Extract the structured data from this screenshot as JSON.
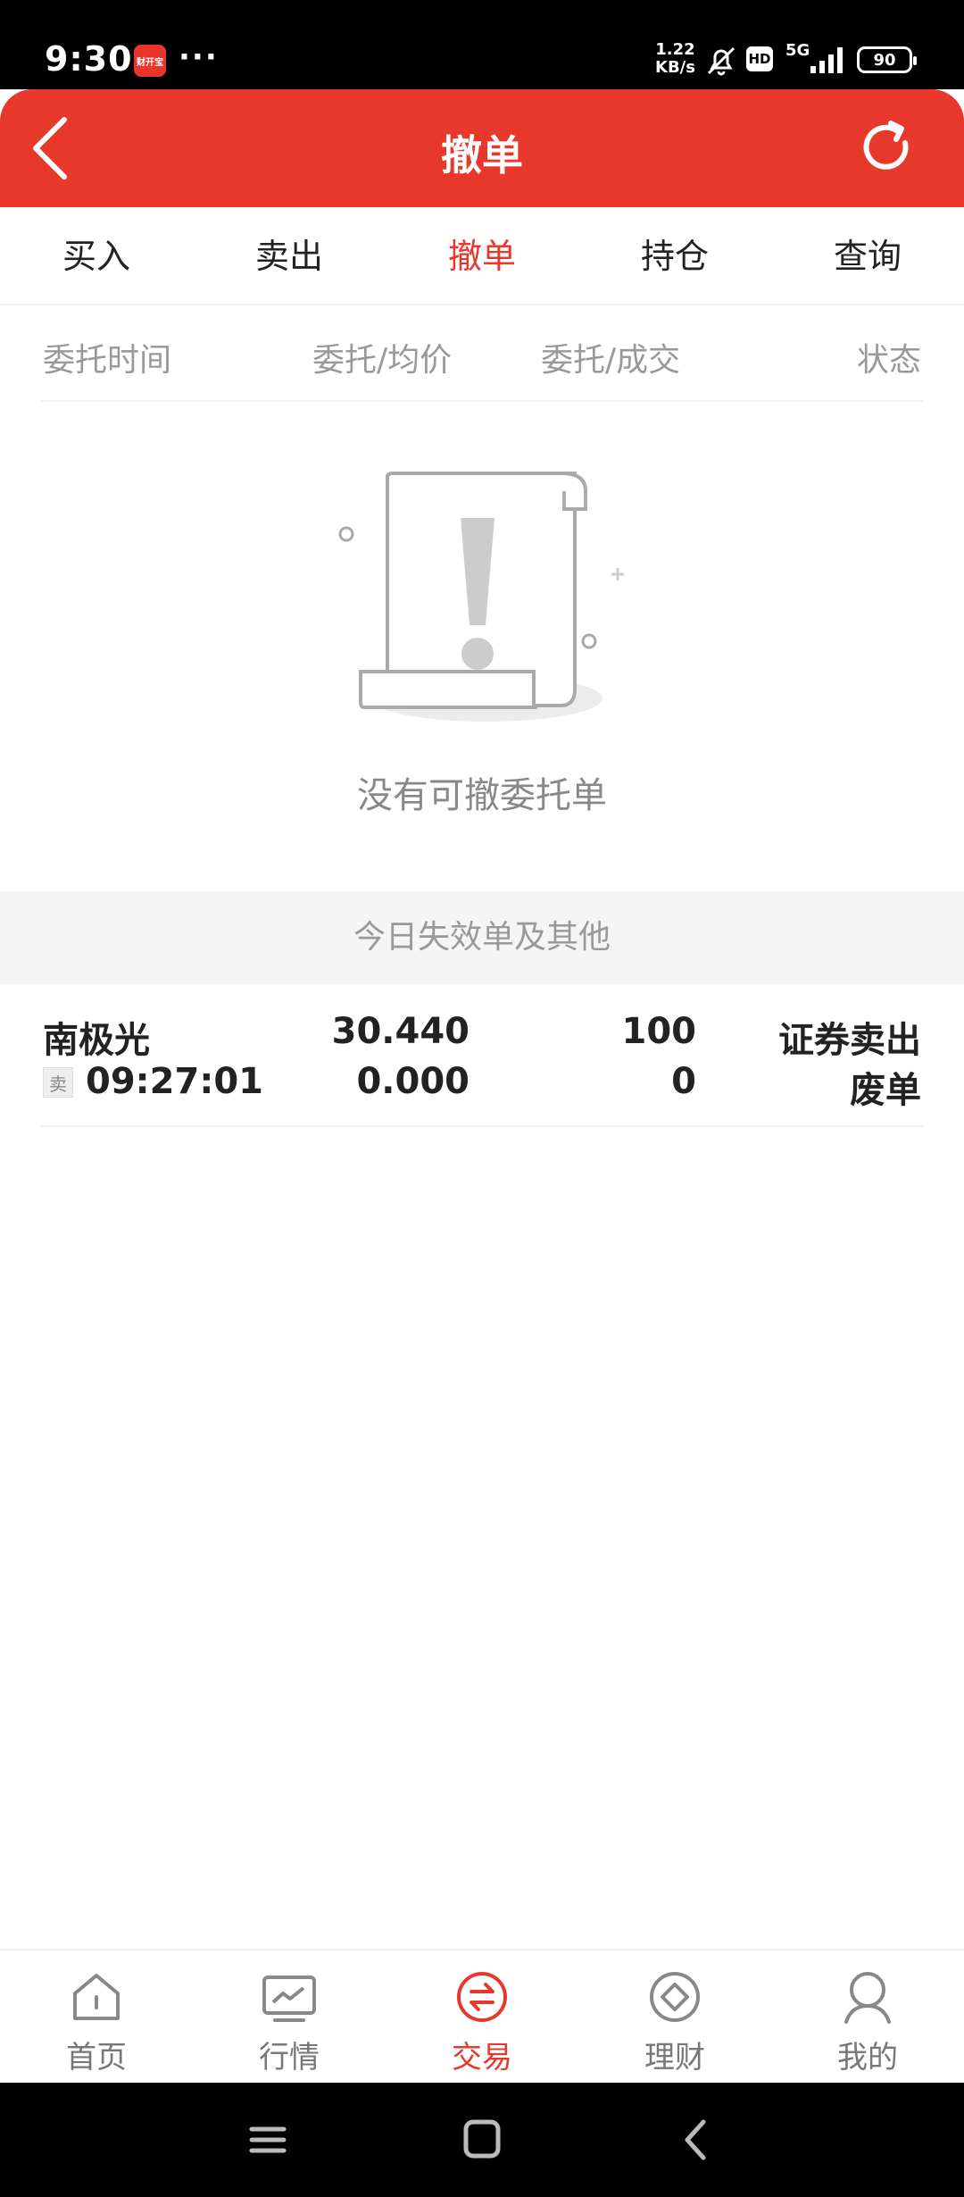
{
  "status_bar": {
    "time": "9:30",
    "app_icon_text": "财开宝",
    "more": "···",
    "net_speed_value": "1.22",
    "net_speed_unit": "KB/s",
    "hd": "HD",
    "network": "5G",
    "battery": "90"
  },
  "header": {
    "title": "撤单"
  },
  "tabs": [
    {
      "label": "买入"
    },
    {
      "label": "卖出"
    },
    {
      "label": "撤单"
    },
    {
      "label": "持仓"
    },
    {
      "label": "查询"
    }
  ],
  "active_tab": "撤单",
  "columns": {
    "time": "委托时间",
    "price": "委托/均价",
    "qty": "委托/成交",
    "status": "状态"
  },
  "empty_state": {
    "message": "没有可撤委托单"
  },
  "section": {
    "title": "今日失效单及其他"
  },
  "orders": [
    {
      "name": "南极光",
      "side_tag": "卖",
      "time": "09:27:01",
      "order_price": "30.440",
      "avg_price": "0.000",
      "order_qty": "100",
      "deal_qty": "0",
      "type": "证券卖出",
      "status": "废单"
    }
  ],
  "bottom_nav": [
    {
      "label": "首页",
      "icon": "home-icon"
    },
    {
      "label": "行情",
      "icon": "market-chart-icon"
    },
    {
      "label": "交易",
      "icon": "trade-exchange-icon"
    },
    {
      "label": "理财",
      "icon": "wealth-diamond-icon"
    },
    {
      "label": "我的",
      "icon": "profile-icon"
    }
  ],
  "active_nav": "交易",
  "colors": {
    "brand_red": "#e8382b",
    "muted_text": "#999999",
    "band_bg": "#f5f5f5"
  }
}
